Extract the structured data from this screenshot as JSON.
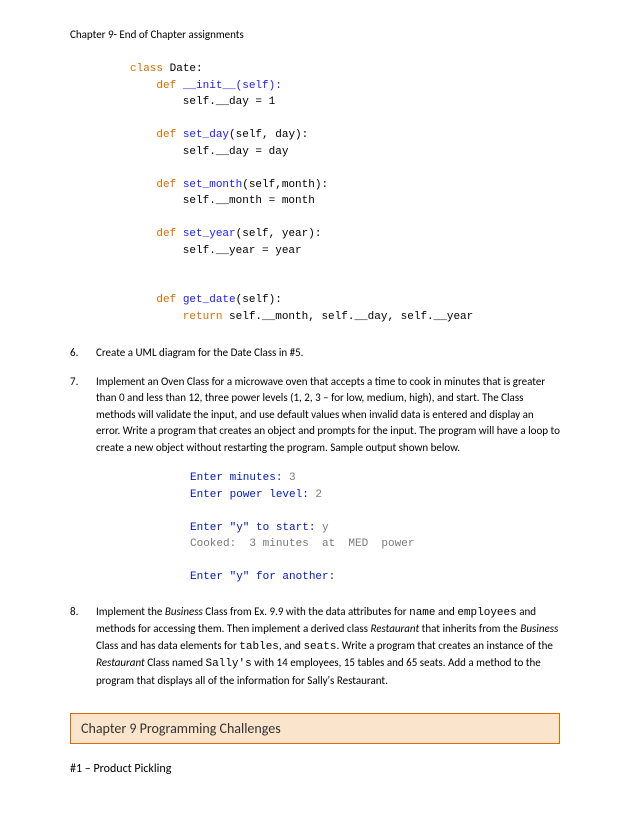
{
  "header": "Chapter 9- End of Chapter assignments",
  "code": {
    "l1a": "class",
    "l1b": " Date:",
    "l2a": "def",
    "l2b": " __init__(self):",
    "l3": "        self.__day = 1",
    "l4a": "def",
    "l4b": " set_day",
    "l4c": "(self, day):",
    "l5": "        self.__day = day",
    "l6a": "def",
    "l6b": " set_month",
    "l6c": "(self,month):",
    "l7": "        self.__month = month",
    "l8a": "def",
    "l8b": " set_year",
    "l8c": "(self, year):",
    "l9": "        self.__year = year",
    "l10a": "def",
    "l10b": " get_date",
    "l10c": "(self):",
    "l11a": "        return",
    "l11b": " self.__month, self.__day, self.__year"
  },
  "q6": {
    "num": "6.",
    "text": "Create a UML diagram for the Date Class in #5."
  },
  "q7": {
    "num": "7.",
    "text": "Implement an Oven Class for a microwave oven that accepts a time to cook in minutes that is greater than 0 and less than 12, three power levels (1, 2, 3 – for low, medium, high), and start. The Class methods will validate the input, and use default values when invalid data is entered and display an error. Write a program that creates an object and prompts for the input. The program will have a loop to create a new object without restarting the program. Sample output shown below."
  },
  "sample": {
    "s1": "Enter minutes: ",
    "s1v": "3",
    "s2": "Enter power level: ",
    "s2v": "2",
    "s3": "Enter \"y\" to start: ",
    "s3v": "y",
    "s4": "Cooked:  3 minutes  at  MED  power",
    "s5": "Enter \"y\" for another:"
  },
  "q8": {
    "num": "8.",
    "p1": "Implement the ",
    "business": "Business",
    "p2": " Class from Ex. 9.9 with the data attributes for ",
    "name": "name",
    "p3": " and ",
    "employees": "employees",
    "p4": " and methods for accessing them. Then implement a derived class ",
    "restaurant": "Restaurant",
    "p5": " that inherits from the ",
    "p6": " Class and has data elements for ",
    "tables": "tables",
    "p7": ", and ",
    "seats": "seats",
    "p8": ". Write a program that creates an instance of the ",
    "p9": " Class named ",
    "sallys": "Sally's",
    "p10": " with 14 employees, 15 tables and 65 seats. Add a method to the program that displays all of the information for Sally's Restaurant."
  },
  "section": "Chapter 9 Programming Challenges",
  "challenge1": "#1 – Product Pickling"
}
